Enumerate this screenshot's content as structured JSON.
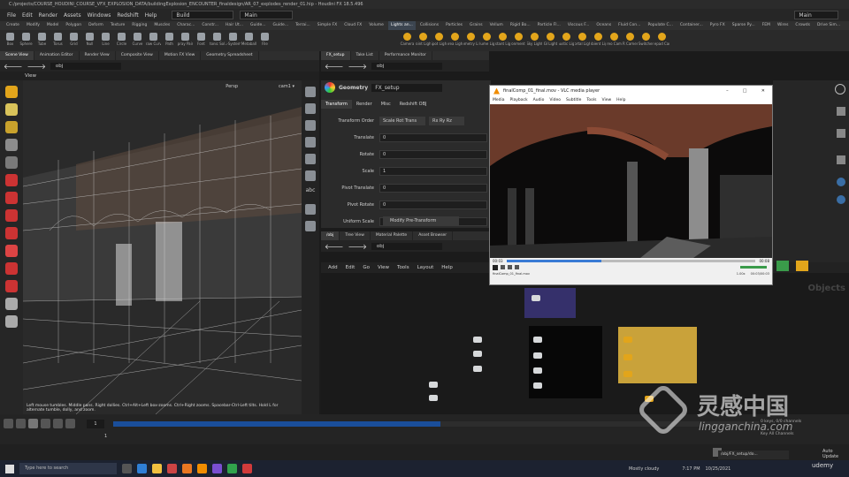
{
  "window_title": "C:/projects/COURSE_HOUDINI_COURSE_VFX_EXPLOSION_DATA/buildingExplosion_ENCOUNTER_finaldesign/AR_07_explodes_render_01.hip - Houdini FX 18.5.496",
  "menu": {
    "items": [
      "File",
      "Edit",
      "Render",
      "Assets",
      "Windows",
      "Redshift",
      "Help"
    ],
    "desktop": "Build",
    "context": "Main",
    "right_context": "Main"
  },
  "shelf_tabs": [
    "Create",
    "Modify",
    "Model",
    "Polygon",
    "Deform",
    "Texture",
    "Rigging",
    "Muscles",
    "Charac...",
    "Constr...",
    "Hair Ut...",
    "Guide...",
    "Guide...",
    "Terrai...",
    "Simple FX",
    "Cloud FX",
    "Volume",
    "Lights an...",
    "Collisions",
    "Particles",
    "Grains",
    "Vellum",
    "Rigid Bo...",
    "Particle Fl...",
    "Viscous F...",
    "Oceans",
    "Fluid Con...",
    "Populate C...",
    "Container...",
    "Pyro FX",
    "Sparse Py...",
    "FEM",
    "Wires",
    "Crowds",
    "Drive Sim..."
  ],
  "shelf_tools": [
    "Box",
    "Sphere",
    "Tube",
    "Torus",
    "Grid",
    "Null",
    "Line",
    "Circle",
    "Curve",
    "Draw Curve",
    "Path",
    "Spray Paint",
    "Font",
    "Platonic Solids",
    "L-System",
    "Metaball",
    "File"
  ],
  "light_tools": [
    "Camera",
    "Point Light",
    "Spot Light",
    "Area Light",
    "Geometry Light",
    "Volume Light",
    "Distant Light",
    "Environment Light",
    "Sky Light",
    "GI Light",
    "Caustic Light",
    "Portal Light",
    "Ambient Light",
    "Stereo Camera",
    "VR Camera",
    "Switcher",
    "Gamepad Camera"
  ],
  "left_tabs": [
    "Scene View",
    "Animation Editor",
    "Render View",
    "Composite View",
    "Motion FX View",
    "Geometry Spreadsheet"
  ],
  "left_path": "obj",
  "viewport_label": "View",
  "viewport_persp": "Persp",
  "viewport_cam": "cam1 ▾",
  "viewport_help": "Left mouse tumbles. Middle pans. Right dollies. Ctrl+Alt+Left box-zooms. Ctrl+Right zooms. Spacebar-Ctrl-Left tilts. Hold L for alternate tumble, dolly, and zoom.",
  "param_tabs": [
    "FX_setup",
    "Take List",
    "Performance Monitor"
  ],
  "param_path": "obj",
  "param_node_type": "Geometry",
  "param_node_name": "FX_setup",
  "param_subtabs": [
    "Transform",
    "Render",
    "Misc",
    "Redshift OBJ"
  ],
  "params": [
    {
      "label": "Transform Order",
      "value": "Scale Rot Trans",
      "value2": "Rx Ry Rz"
    },
    {
      "label": "Translate",
      "value": "0"
    },
    {
      "label": "Rotate",
      "value": "0"
    },
    {
      "label": "Scale",
      "value": "1"
    },
    {
      "label": "Pivot Translate",
      "value": "0"
    },
    {
      "label": "Pivot Rotate",
      "value": "0"
    },
    {
      "label": "Uniform Scale",
      "value": "1"
    }
  ],
  "modify_pretransform": "Modify Pre-Transform",
  "net_tabs": [
    "/obj",
    "Tree View",
    "Material Palette",
    "Asset Browser"
  ],
  "net_path": "obj",
  "net_menu": [
    "Add",
    "Edit",
    "Go",
    "View",
    "Tools",
    "Layout",
    "Help"
  ],
  "net_objects_label": "Objects",
  "vlc": {
    "title": "finalComp_01_final.mov - VLC media player",
    "menu": [
      "Media",
      "Playback",
      "Audio",
      "Video",
      "Subtitle",
      "Tools",
      "View",
      "Help"
    ],
    "time_left": "00:03",
    "time_right": "00:08",
    "status_file": "finalComp_01_final.mov",
    "status_speed": "1.00x",
    "status_time": "00:03/00:03",
    "progress": 0.38
  },
  "timeline": {
    "frame_start": "1",
    "frame_end": "1",
    "info": "0 keys, 0/0 channels",
    "key_all": "Key All Channels",
    "auto_update": "Auto Update"
  },
  "taskbar": {
    "search_placeholder": "Type here to search",
    "weather": "Mostly cloudy",
    "time": "7:17 PM",
    "date": "10/25/2021",
    "active_window": "/obj/FX_setup/do...",
    "udemy": "udemy"
  },
  "watermark": {
    "cn": "灵感中国",
    "en": "lingganchina.com"
  },
  "accent": "#e2a51b"
}
